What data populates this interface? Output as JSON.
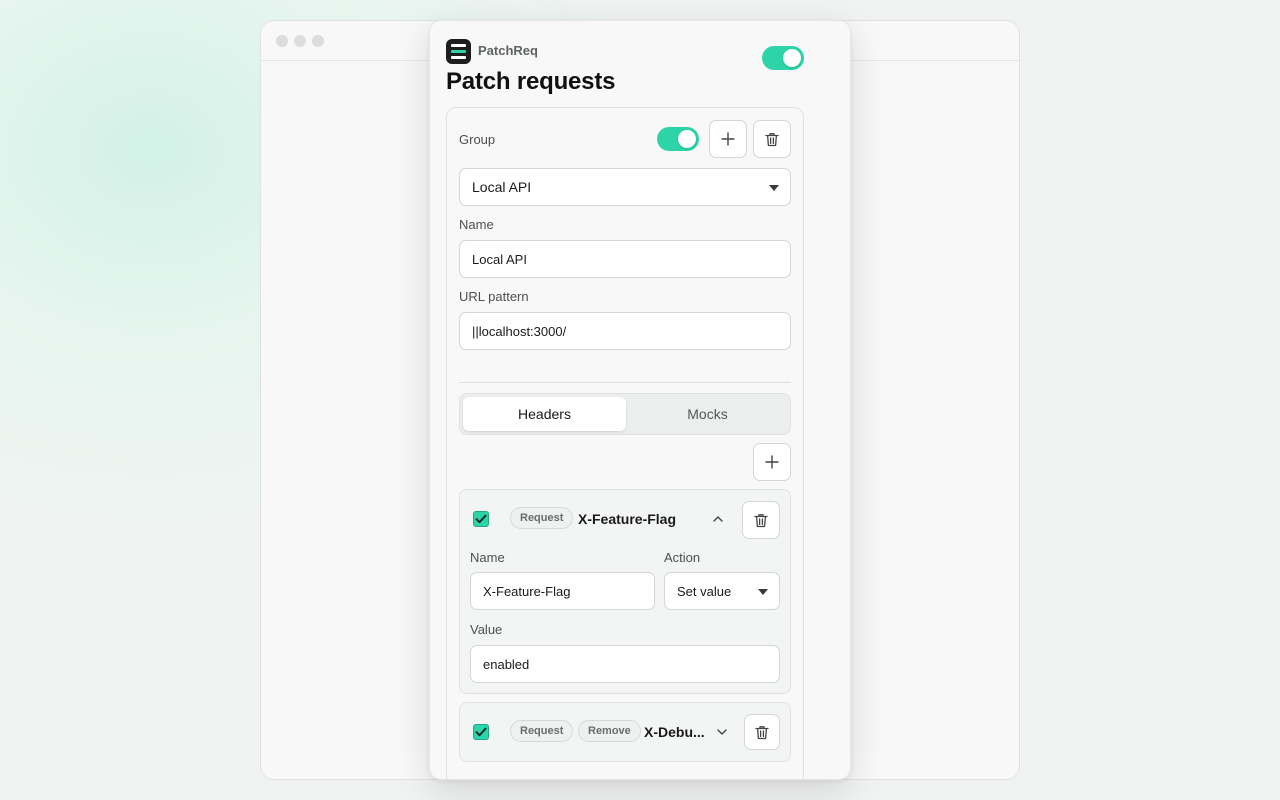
{
  "app": {
    "name": "PatchReq",
    "title": "Patch requests"
  },
  "accent_color": "#2dd4a7",
  "group": {
    "label": "Group",
    "enabled": true,
    "selected": "Local API",
    "name_label": "Name",
    "name_value": "Local API",
    "url_label": "URL pattern",
    "url_value": "||localhost:3000/"
  },
  "tabs": [
    {
      "label": "Headers",
      "active": true
    },
    {
      "label": "Mocks",
      "active": false
    }
  ],
  "rules": [
    {
      "checked": true,
      "badge_type": "Request",
      "header_name": "X-Feature-Flag",
      "expanded": true,
      "name_label": "Name",
      "name_value": "X-Feature-Flag",
      "action_label": "Action",
      "action_value": "Set value",
      "value_label": "Value",
      "value_value": "enabled"
    },
    {
      "checked": true,
      "badge_type": "Request",
      "badge_action": "Remove",
      "header_name": "X-Debu...",
      "expanded": false
    }
  ],
  "icons": {
    "add": "plus-icon",
    "delete": "trash-icon",
    "collapse": "chevron-up-icon",
    "expand": "chevron-down-icon",
    "dropdown": "caret-down-icon"
  }
}
